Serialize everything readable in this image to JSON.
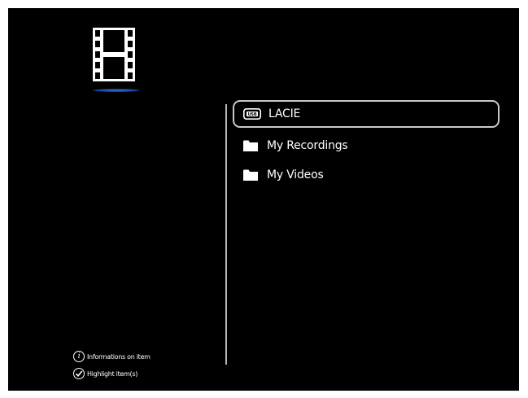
{
  "header": {
    "icon": "film-strip-icon"
  },
  "list": {
    "items": [
      {
        "label": "LACIE",
        "icon": "usb-drive-icon",
        "selected": true
      },
      {
        "label": "My Recordings",
        "icon": "folder-icon",
        "selected": false
      },
      {
        "label": "My Videos",
        "icon": "folder-icon",
        "selected": false
      }
    ]
  },
  "hints": {
    "info_label": "Informations on item",
    "info_icon_glyph": "i",
    "highlight_label": "Highlight item(s)"
  },
  "colors": {
    "background": "#000000",
    "text": "#ffffff",
    "selection_border": "#c9c9c9",
    "accent_underline": "#2f6fd6"
  }
}
